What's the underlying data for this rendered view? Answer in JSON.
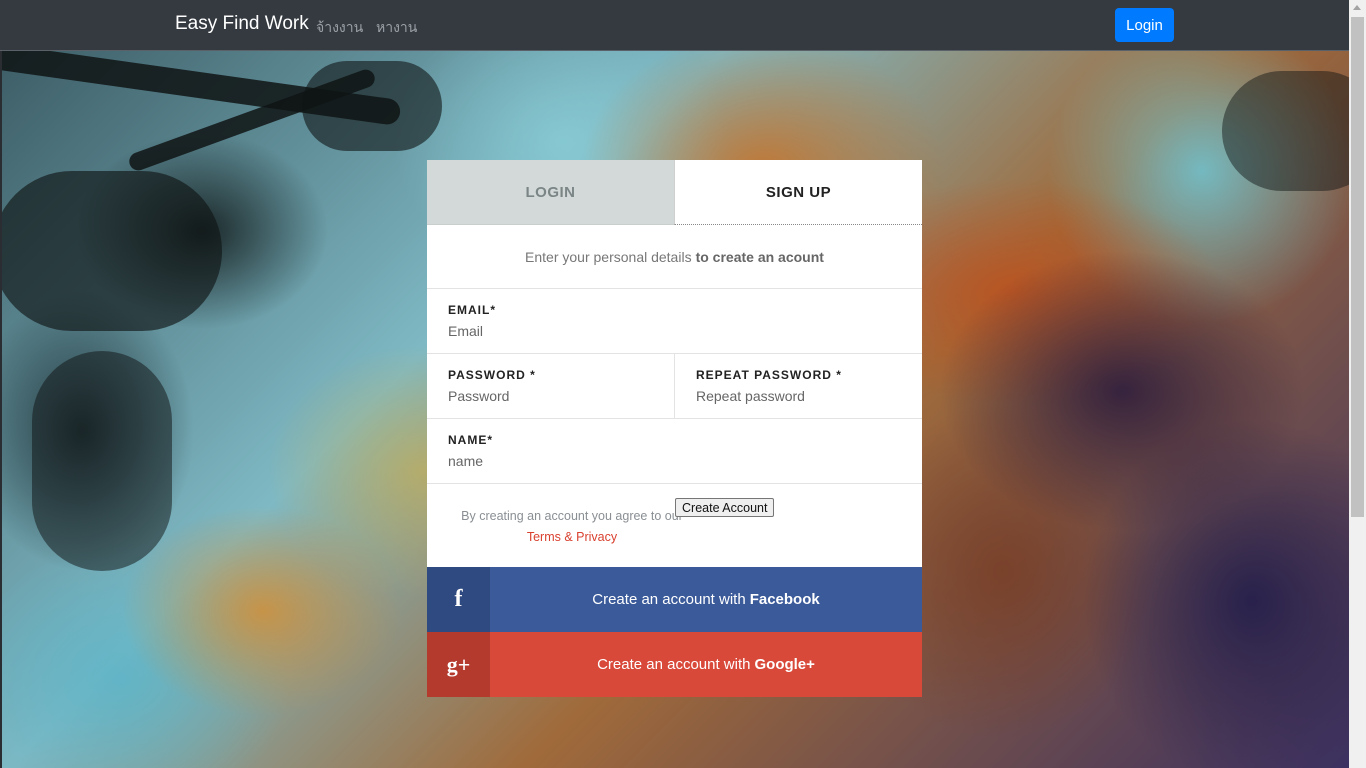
{
  "navbar": {
    "brand": "Easy Find Work",
    "links": [
      "จ้างงาน",
      "หางาน"
    ],
    "login_label": "Login"
  },
  "tabs": {
    "login": "LOGIN",
    "signup": "SIGN UP"
  },
  "intro": {
    "text": "Enter your personal details",
    "bold": "to create an acount"
  },
  "form": {
    "email": {
      "label": "EMAIL*",
      "placeholder": "Email"
    },
    "password": {
      "label": "PASSWORD *",
      "placeholder": "Password"
    },
    "repeat_password": {
      "label": "REPEAT PASSWORD *",
      "placeholder": "Repeat password"
    },
    "name": {
      "label": "NAME*",
      "placeholder": "name"
    }
  },
  "terms": {
    "text": "By creating an account you agree to our",
    "link": "Terms & Privacy"
  },
  "create_button": "Create Account",
  "social": {
    "facebook": {
      "icon": "f",
      "text": "Create an account with",
      "bold": "Facebook",
      "color": "#3b5a9a"
    },
    "google": {
      "icon": "g+",
      "text": "Create an account with",
      "bold": "Google+",
      "color": "#d9493a"
    }
  },
  "colors": {
    "navbar": "#343a40",
    "primary": "#007bff",
    "terms_link": "#d9412f"
  }
}
